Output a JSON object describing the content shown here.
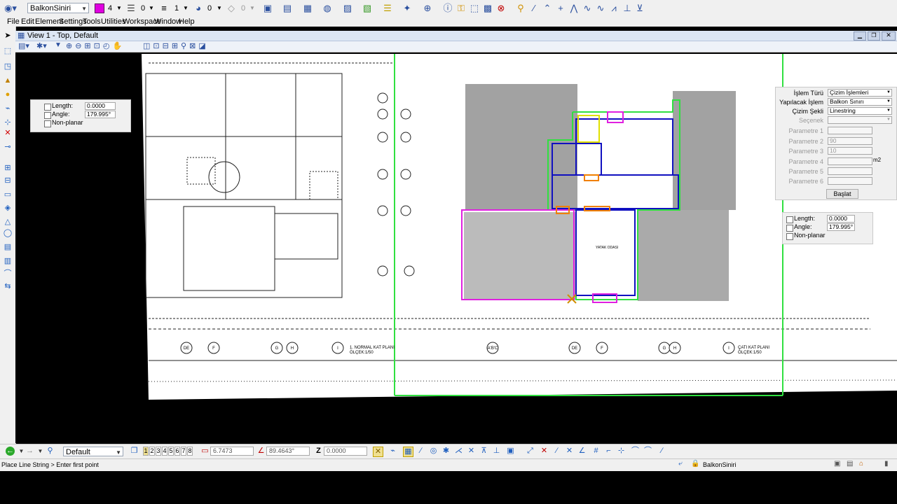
{
  "toolbar": {
    "level": "BalkonSiniri",
    "color_index": "4",
    "color_swatch": "#e000e0",
    "line_style": "0",
    "line_weight": "1",
    "transparency": "0",
    "priority": "0"
  },
  "menu": [
    "File",
    "Edit",
    "Element",
    "Settings",
    "Tools",
    "Utilities",
    "Workspace",
    "Window",
    "Help"
  ],
  "view": {
    "title": "View 1 - Top, Default"
  },
  "accudraw_left": {
    "length_label": "Length:",
    "length_value": "0.0000",
    "angle_label": "Angle:",
    "angle_value": "179.995°",
    "nonplanar_label": "Non-planar"
  },
  "tool_settings": {
    "islem_turu_label": "İşlem Türü",
    "islem_turu_value": "Çizim İşlemleri",
    "yapilacak_label": "Yapılacak İşlem",
    "yapilacak_value": "Balkon Sınırı",
    "cizim_sekli_label": "Çizim Şekli",
    "cizim_sekli_value": "Linestring",
    "secenek_label": "Seçenek",
    "secenek_value": "",
    "param1_label": "Parametre 1",
    "param1_value": "",
    "param2_label": "Parametre 2",
    "param2_value": "90",
    "param3_label": "Parametre 3",
    "param3_value": "10",
    "param4_label": "Parametre 4",
    "param4_value": "",
    "param4_unit": "m2",
    "param5_label": "Parametre 5",
    "param5_value": "",
    "param6_label": "Parametre 6",
    "param6_value": "",
    "baslat_button": "Başlat"
  },
  "accudraw_right": {
    "length_label": "Length:",
    "length_value": "0.0000",
    "angle_label": "Angle:",
    "angle_value": "179.995°",
    "nonplanar_label": "Non-planar"
  },
  "drawing_labels": {
    "plan_left": "1. NORMAL KAT PLANI",
    "scale_left": "ÖLÇEK:1/50",
    "plan_right": "ÇATI KAT PLANI",
    "scale_right": "ÖLÇEK:1/50",
    "room_yatak": "YATAK ODASI",
    "grid_labels": [
      "DE",
      "F",
      "G",
      "H",
      "I",
      "A'B'C",
      "DE",
      "F",
      "G",
      "H",
      "I"
    ]
  },
  "bottom": {
    "model": "Default",
    "view_numbers": [
      "1",
      "2",
      "3",
      "4",
      "5",
      "6",
      "7",
      "8"
    ],
    "x_value": "6.7473",
    "angle_value": "89.4643°",
    "z_label": "Z",
    "z_value": "0.0000"
  },
  "status": {
    "prompt": "Place Line String > Enter first point",
    "active_level": "BalkonSiniri"
  }
}
